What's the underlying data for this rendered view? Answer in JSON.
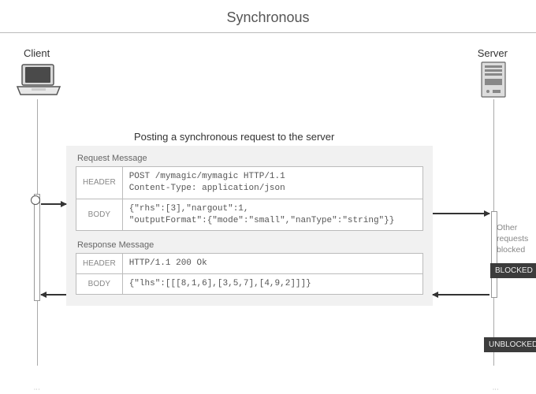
{
  "title": "Synchronous",
  "client_label": "Client",
  "server_label": "Server",
  "subtitle": "Posting a synchronous request to the server",
  "request": {
    "section": "Request Message",
    "header_label": "HEADER",
    "body_label": "BODY",
    "header": "POST /mymagic/mymagic HTTP/1.1\nContent-Type: application/json",
    "body": "{\"rhs\":[3],\"nargout\":1,\n\"outputFormat\":{\"mode\":\"small\",\"nanType\":\"string\"}}"
  },
  "response": {
    "section": "Response Message",
    "header_label": "HEADER",
    "body_label": "BODY",
    "header": "HTTP/1.1 200 Ok",
    "body": "{\"lhs\":[[[8,1,6],[3,5,7],[4,9,2]]]}"
  },
  "side_note": "Other requests blocked",
  "blocked_tag": "BLOCKED",
  "unblocked_tag": "UNBLOCKED"
}
